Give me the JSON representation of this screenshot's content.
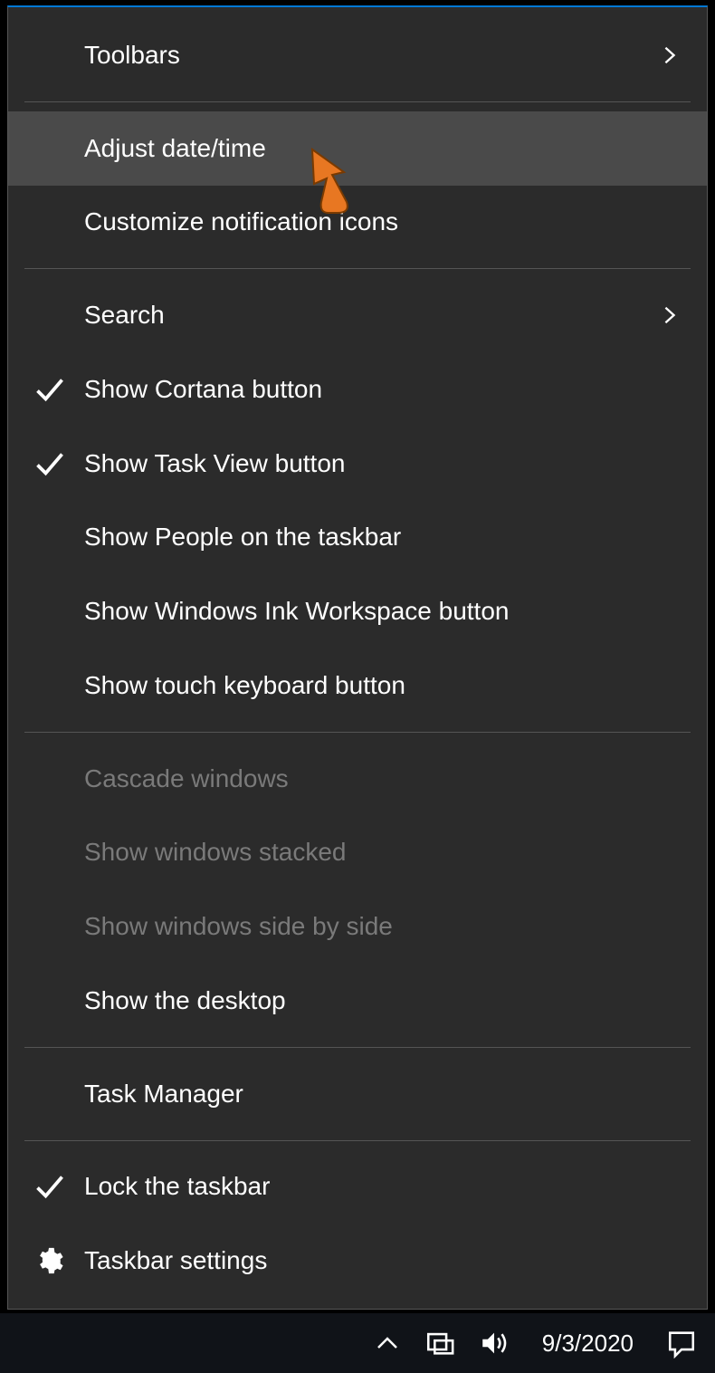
{
  "menu": {
    "groups": [
      [
        {
          "id": "toolbars",
          "label": "Toolbars",
          "submenu": true,
          "checked": false,
          "disabled": false,
          "highlighted": false,
          "icon": null
        }
      ],
      [
        {
          "id": "adjust-date-time",
          "label": "Adjust date/time",
          "submenu": false,
          "checked": false,
          "disabled": false,
          "highlighted": true,
          "icon": null
        },
        {
          "id": "customize-notification-icons",
          "label": "Customize notification icons",
          "submenu": false,
          "checked": false,
          "disabled": false,
          "highlighted": false,
          "icon": null
        }
      ],
      [
        {
          "id": "search",
          "label": "Search",
          "submenu": true,
          "checked": false,
          "disabled": false,
          "highlighted": false,
          "icon": null
        },
        {
          "id": "show-cortana-button",
          "label": "Show Cortana button",
          "submenu": false,
          "checked": true,
          "disabled": false,
          "highlighted": false,
          "icon": null
        },
        {
          "id": "show-task-view-button",
          "label": "Show Task View button",
          "submenu": false,
          "checked": true,
          "disabled": false,
          "highlighted": false,
          "icon": null
        },
        {
          "id": "show-people-on-taskbar",
          "label": "Show People on the taskbar",
          "submenu": false,
          "checked": false,
          "disabled": false,
          "highlighted": false,
          "icon": null
        },
        {
          "id": "show-windows-ink-workspace-button",
          "label": "Show Windows Ink Workspace button",
          "submenu": false,
          "checked": false,
          "disabled": false,
          "highlighted": false,
          "icon": null
        },
        {
          "id": "show-touch-keyboard-button",
          "label": "Show touch keyboard button",
          "submenu": false,
          "checked": false,
          "disabled": false,
          "highlighted": false,
          "icon": null
        }
      ],
      [
        {
          "id": "cascade-windows",
          "label": "Cascade windows",
          "submenu": false,
          "checked": false,
          "disabled": true,
          "highlighted": false,
          "icon": null
        },
        {
          "id": "show-windows-stacked",
          "label": "Show windows stacked",
          "submenu": false,
          "checked": false,
          "disabled": true,
          "highlighted": false,
          "icon": null
        },
        {
          "id": "show-windows-side-by-side",
          "label": "Show windows side by side",
          "submenu": false,
          "checked": false,
          "disabled": true,
          "highlighted": false,
          "icon": null
        },
        {
          "id": "show-the-desktop",
          "label": "Show the desktop",
          "submenu": false,
          "checked": false,
          "disabled": false,
          "highlighted": false,
          "icon": null
        }
      ],
      [
        {
          "id": "task-manager",
          "label": "Task Manager",
          "submenu": false,
          "checked": false,
          "disabled": false,
          "highlighted": false,
          "icon": null
        }
      ],
      [
        {
          "id": "lock-the-taskbar",
          "label": "Lock the taskbar",
          "submenu": false,
          "checked": true,
          "disabled": false,
          "highlighted": false,
          "icon": null
        },
        {
          "id": "taskbar-settings",
          "label": "Taskbar settings",
          "submenu": false,
          "checked": false,
          "disabled": false,
          "highlighted": false,
          "icon": "gear"
        }
      ]
    ]
  },
  "taskbar": {
    "date": "9/3/2020"
  },
  "annotation": {
    "cursor_target": "adjust-date-time"
  }
}
